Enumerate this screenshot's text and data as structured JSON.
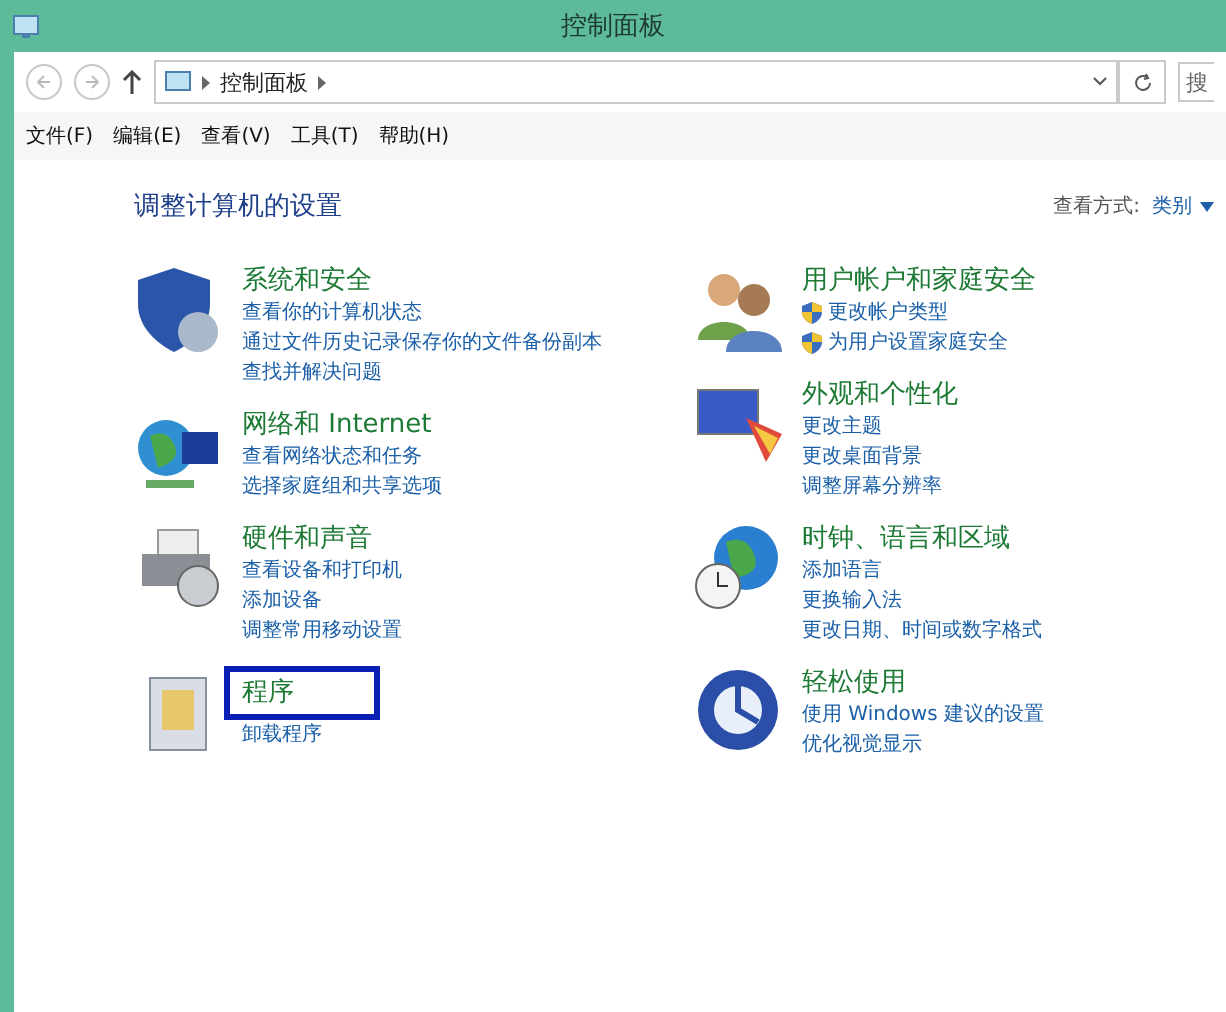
{
  "window": {
    "title": "控制面板"
  },
  "address_bar": {
    "path": [
      "控制面板"
    ],
    "search_placeholder": "搜"
  },
  "menu": [
    "文件(F)",
    "编辑(E)",
    "查看(V)",
    "工具(T)",
    "帮助(H)"
  ],
  "heading": "调整计算机的设置",
  "view_by": {
    "label": "查看方式:",
    "value": "类别"
  },
  "columns": [
    [
      {
        "kind": "shield",
        "title": "系统和安全",
        "highlighted": false,
        "links": [
          {
            "text": "查看你的计算机状态",
            "shield": false
          },
          {
            "text": "通过文件历史记录保存你的文件备份副本",
            "shield": false
          },
          {
            "text": "查找并解决问题",
            "shield": false
          }
        ]
      },
      {
        "kind": "network",
        "title": "网络和 Internet",
        "highlighted": false,
        "links": [
          {
            "text": "查看网络状态和任务",
            "shield": false
          },
          {
            "text": "选择家庭组和共享选项",
            "shield": false
          }
        ]
      },
      {
        "kind": "printer",
        "title": "硬件和声音",
        "highlighted": false,
        "links": [
          {
            "text": "查看设备和打印机",
            "shield": false
          },
          {
            "text": "添加设备",
            "shield": false
          },
          {
            "text": "调整常用移动设置",
            "shield": false
          }
        ]
      },
      {
        "kind": "programs",
        "title": "程序",
        "highlighted": true,
        "links": [
          {
            "text": "卸载程序",
            "shield": false
          }
        ]
      }
    ],
    [
      {
        "kind": "users",
        "title": "用户帐户和家庭安全",
        "highlighted": false,
        "links": [
          {
            "text": "更改帐户类型",
            "shield": true
          },
          {
            "text": "为用户设置家庭安全",
            "shield": true
          }
        ]
      },
      {
        "kind": "display",
        "title": "外观和个性化",
        "highlighted": false,
        "links": [
          {
            "text": "更改主题",
            "shield": false
          },
          {
            "text": "更改桌面背景",
            "shield": false
          },
          {
            "text": "调整屏幕分辨率",
            "shield": false
          }
        ]
      },
      {
        "kind": "globe",
        "title": "时钟、语言和区域",
        "highlighted": false,
        "links": [
          {
            "text": "添加语言",
            "shield": false
          },
          {
            "text": "更换输入法",
            "shield": false
          },
          {
            "text": "更改日期、时间或数字格式",
            "shield": false
          }
        ]
      },
      {
        "kind": "access",
        "title": "轻松使用",
        "highlighted": false,
        "links": [
          {
            "text": "使用 Windows 建议的设置",
            "shield": false
          },
          {
            "text": "优化视觉显示",
            "shield": false
          }
        ]
      }
    ]
  ]
}
